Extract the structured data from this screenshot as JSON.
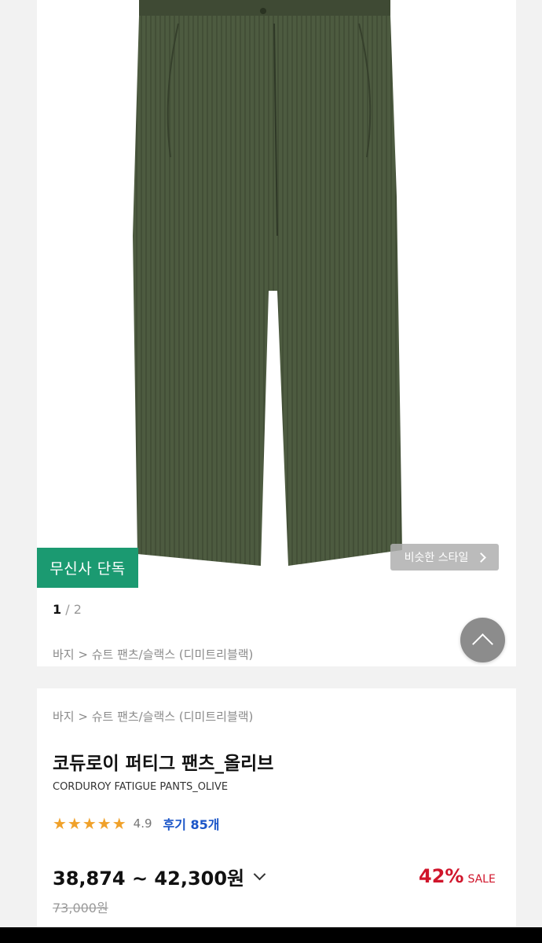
{
  "gallery": {
    "badge": "무신사 단독",
    "similar_style": "비슷한 스타일",
    "pager_current": "1",
    "pager_sep": " / ",
    "pager_total": "2",
    "breadcrumb": "바지 > 슈트 팬츠/슬랙스 (디미트리블랙)"
  },
  "product": {
    "breadcrumb": "바지 > 슈트 팬츠/슬랙스 (디미트리블랙)",
    "title_ko": "코듀로이 퍼티그 팬츠_올리브",
    "title_en": "CORDUROY FATIGUE PANTS_OLIVE",
    "stars": "★★★★★",
    "rating": "4.9",
    "reviews": "후기 85개",
    "price": "38,874 ~ 42,300원",
    "discount": "42%",
    "sale": "SALE",
    "original_price": "73,000원"
  },
  "colors": {
    "badge": "#1b9a71",
    "reviews_link": "#1a55c8",
    "discount": "#d0152b",
    "stars": "#f0a12a",
    "pants": "#4c5a3f"
  },
  "icons": [
    "chevron-right-icon",
    "arrow-up-icon",
    "chevron-down-icon",
    "star-icon"
  ]
}
